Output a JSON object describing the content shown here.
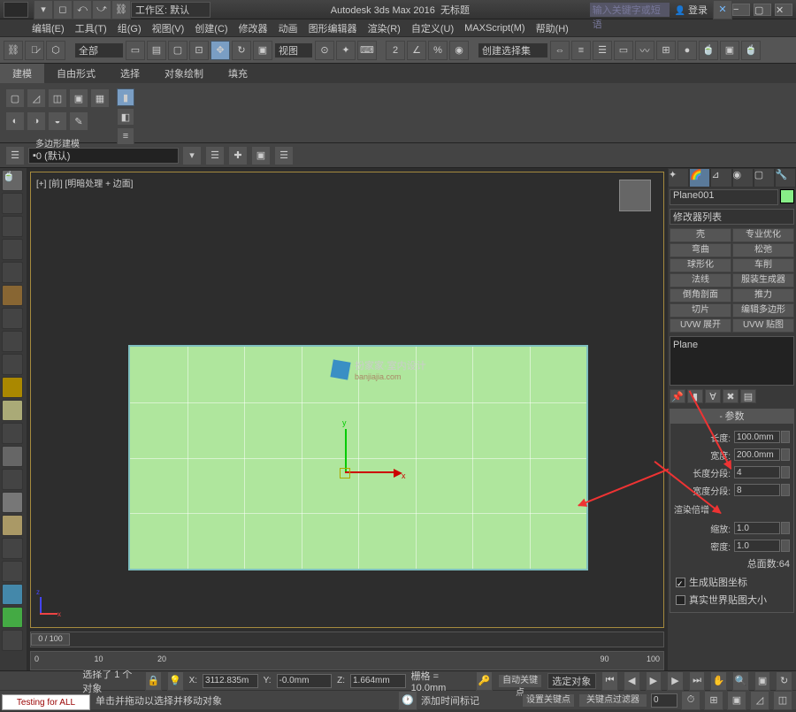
{
  "title": {
    "app": "Autodesk 3ds Max 2016",
    "file": "无标题",
    "workspace_label": "工作区: 默认",
    "search_placeholder": "输入关键字或短语",
    "login": "登录"
  },
  "menu": [
    "编辑(E)",
    "工具(T)",
    "组(G)",
    "视图(V)",
    "创建(C)",
    "修改器",
    "动画",
    "图形编辑器",
    "渲染(R)",
    "自定义(U)",
    "MAXScript(M)",
    "帮助(H)"
  ],
  "toolbar": {
    "dropdown": "全部",
    "selection_set": "创建选择集"
  },
  "ribbon": {
    "tabs": [
      "建模",
      "自由形式",
      "选择",
      "对象绘制",
      "填充"
    ],
    "footer": "多边形建模"
  },
  "layer_dropdown": "0 (默认)",
  "viewport": {
    "label": "[+] [前] [明暗处理 + 边面]",
    "watermark": "扮家家·室内设计",
    "watermark_sub": "banjiajia.com"
  },
  "time": {
    "slider": "0 / 100",
    "tick0": "0",
    "tick10": "10",
    "tick20": "20",
    "tick90": "90",
    "tick100": "100"
  },
  "command_panel": {
    "object_name": "Plane001",
    "modifier_list": "修改器列表",
    "mod_buttons": [
      [
        "壳",
        "专业优化"
      ],
      [
        "弯曲",
        "松弛"
      ],
      [
        "球形化",
        "车削"
      ],
      [
        "法线",
        "服装生成器"
      ],
      [
        "倒角剖面",
        "推力"
      ],
      [
        "切片",
        "编辑多边形"
      ],
      [
        "UVW 展开",
        "UVW 贴图"
      ]
    ],
    "stack_item": "Plane",
    "rollout_params": "参数",
    "length_label": "长度:",
    "length": "100.0mm",
    "width_label": "宽度:",
    "width": "200.0mm",
    "length_segs_label": "长度分段:",
    "length_segs": "4",
    "width_segs_label": "宽度分段:",
    "width_segs": "8",
    "render_mult": "渲染倍增",
    "scale_label": "缩放:",
    "scale": "1.0",
    "density_label": "密度:",
    "density": "1.0",
    "total_faces_label": "总面数:",
    "total_faces": "64",
    "gen_coords": "生成贴图坐标",
    "real_world": "真实世界贴图大小"
  },
  "status": {
    "selected": "选择了 1 个对象",
    "x": "3112.835m",
    "y": "-0.0mm",
    "z": "1.664mm",
    "grid": "栅格 = 10.0mm",
    "hint": "单击并拖动以选择并移动对象",
    "add_time": "添加时间标记",
    "auto_key": "自动关键点",
    "set_key": "设置关键点",
    "key_filter": "选定对象",
    "key_filter2": "关键点过滤器"
  },
  "testing": "Testing for ALL"
}
